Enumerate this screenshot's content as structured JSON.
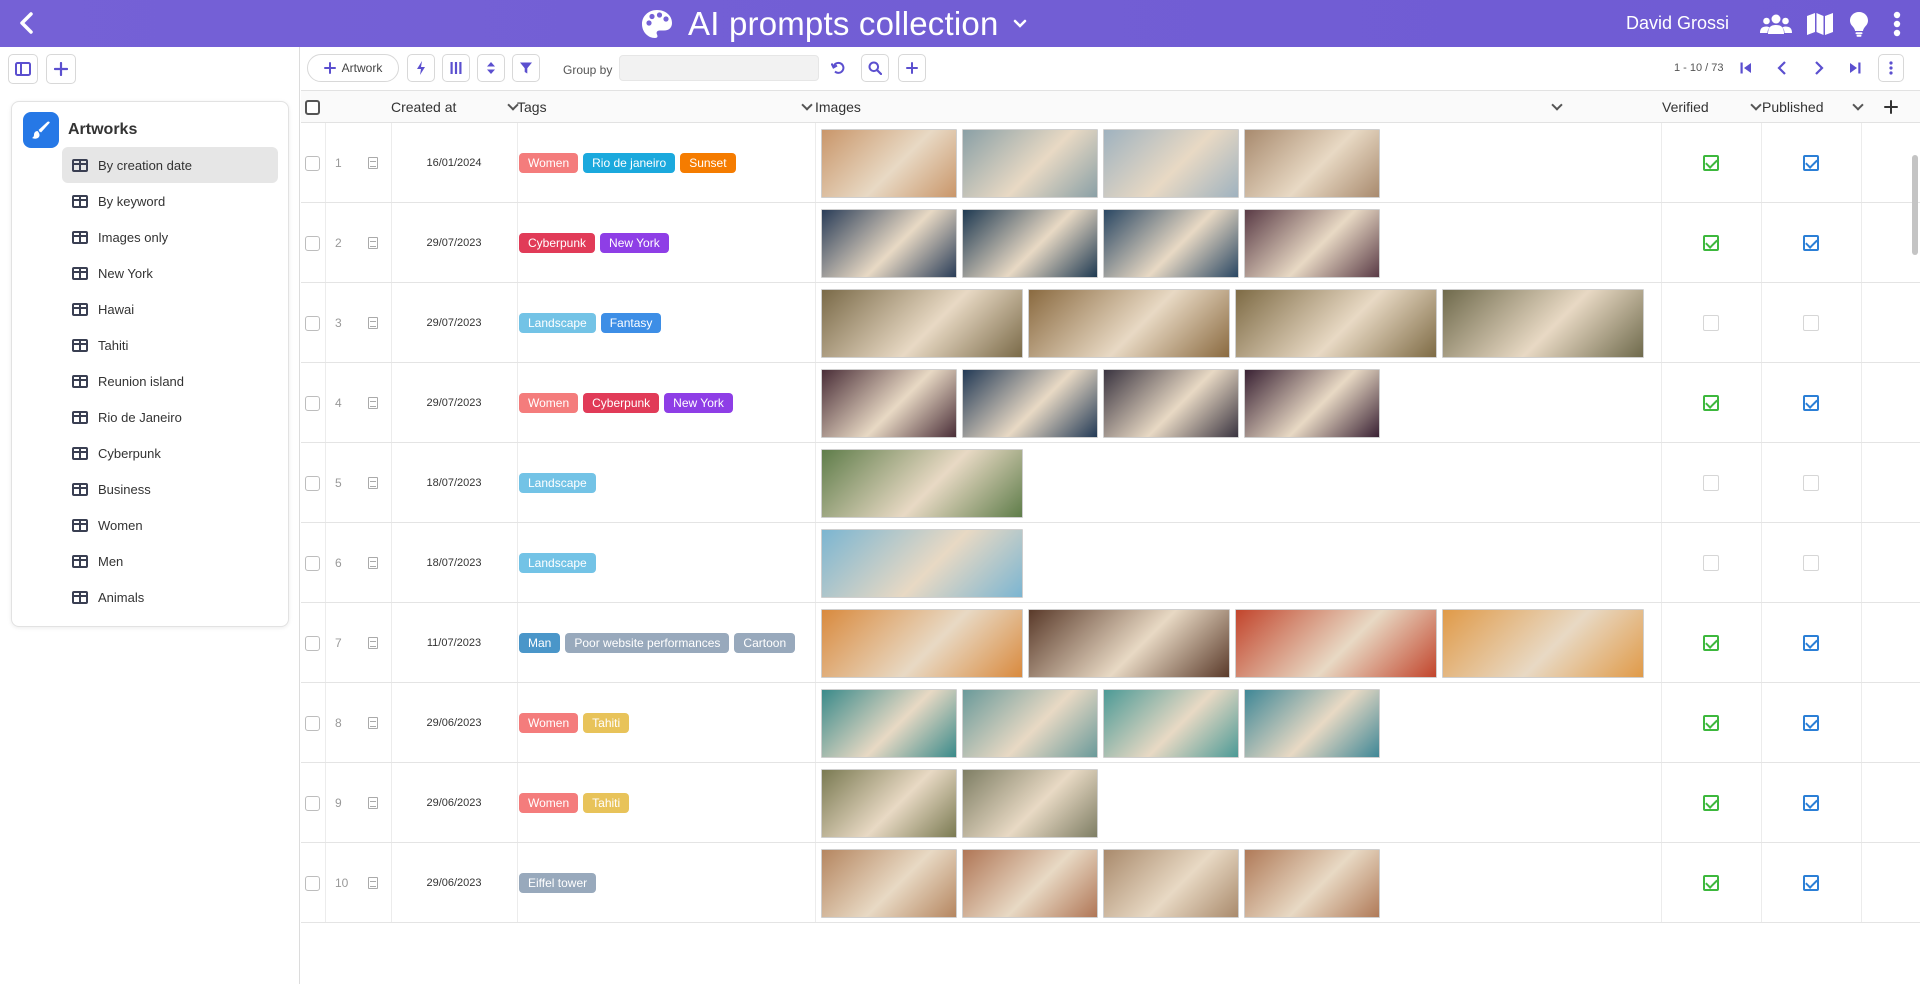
{
  "header": {
    "title": "AI prompts collection",
    "user": "David Grossi",
    "icons": [
      "back-icon",
      "palette-icon",
      "chevron-down-icon",
      "users-icon",
      "map-icon",
      "lightbulb-icon",
      "more-vertical-icon"
    ]
  },
  "sidebar": {
    "category": "Artworks",
    "items": [
      {
        "label": "By creation date",
        "active": true
      },
      {
        "label": "By keyword"
      },
      {
        "label": "Images only"
      },
      {
        "label": "New York"
      },
      {
        "label": "Hawai"
      },
      {
        "label": "Tahiti"
      },
      {
        "label": "Reunion island"
      },
      {
        "label": "Rio de Janeiro"
      },
      {
        "label": "Cyberpunk"
      },
      {
        "label": "Business"
      },
      {
        "label": "Women"
      },
      {
        "label": "Men"
      },
      {
        "label": "Animals"
      }
    ]
  },
  "toolbar": {
    "add_label": "Artwork",
    "group_by_label": "Group by",
    "group_by_value": "",
    "pagination": "1 - 10 / 73"
  },
  "columns": {
    "created_at": "Created at",
    "tags": "Tags",
    "images": "Images",
    "verified": "Verified",
    "published": "Published"
  },
  "colors": {
    "header": "#7561d6",
    "accent": "#5b4fcf",
    "verified": "#3db83d",
    "published": "#2b7fd6"
  },
  "rows": [
    {
      "num": "1",
      "date": "16/01/2024",
      "tags": [
        {
          "label": "Women",
          "color": "#f47c7c"
        },
        {
          "label": "Rio de janeiro",
          "color": "#1ba9dd"
        },
        {
          "label": "Sunset",
          "color": "#f57c00"
        }
      ],
      "images": [
        {
          "w": "n",
          "c": "#c9966a"
        },
        {
          "w": "n",
          "c": "#8aa0a6"
        },
        {
          "w": "n",
          "c": "#9fb2bf"
        },
        {
          "w": "n",
          "c": "#a88a6e"
        }
      ],
      "verified": true,
      "published": true
    },
    {
      "num": "2",
      "date": "29/07/2023",
      "tags": [
        {
          "label": "Cyberpunk",
          "color": "#e13b58"
        },
        {
          "label": "New York",
          "color": "#8e3ee6"
        }
      ],
      "images": [
        {
          "w": "n",
          "c": "#2a3d58"
        },
        {
          "w": "n",
          "c": "#1f3a52"
        },
        {
          "w": "n",
          "c": "#2a4763"
        },
        {
          "w": "n",
          "c": "#5a3b46"
        }
      ],
      "verified": true,
      "published": true
    },
    {
      "num": "3",
      "date": "29/07/2023",
      "tags": [
        {
          "label": "Landscape",
          "color": "#73c3e6"
        },
        {
          "label": "Fantasy",
          "color": "#3d8ee6"
        }
      ],
      "images": [
        {
          "w": "w",
          "c": "#7a6a48"
        },
        {
          "w": "w",
          "c": "#8a6a40"
        },
        {
          "w": "w",
          "c": "#7e6b45"
        },
        {
          "w": "w",
          "c": "#6f6a4c"
        }
      ],
      "verified": false,
      "published": false
    },
    {
      "num": "4",
      "date": "29/07/2023",
      "tags": [
        {
          "label": "Women",
          "color": "#f47c7c"
        },
        {
          "label": "Cyberpunk",
          "color": "#e13b58"
        },
        {
          "label": "New York",
          "color": "#8e3ee6"
        }
      ],
      "images": [
        {
          "w": "n",
          "c": "#4a2e38"
        },
        {
          "w": "n",
          "c": "#233a56"
        },
        {
          "w": "n",
          "c": "#3a3440"
        },
        {
          "w": "n",
          "c": "#3a2234"
        }
      ],
      "verified": true,
      "published": true
    },
    {
      "num": "5",
      "date": "18/07/2023",
      "tags": [
        {
          "label": "Landscape",
          "color": "#73c3e6"
        }
      ],
      "images": [
        {
          "w": "w",
          "c": "#5f7d4a"
        }
      ],
      "verified": false,
      "published": false
    },
    {
      "num": "6",
      "date": "18/07/2023",
      "tags": [
        {
          "label": "Landscape",
          "color": "#73c3e6"
        }
      ],
      "images": [
        {
          "w": "w",
          "c": "#7bb5d1"
        }
      ],
      "verified": false,
      "published": false
    },
    {
      "num": "7",
      "date": "11/07/2023",
      "tags": [
        {
          "label": "Man",
          "color": "#4a96c9"
        },
        {
          "label": "Poor website performances",
          "color": "#98a9bc"
        },
        {
          "label": "Cartoon",
          "color": "#98a9bc"
        }
      ],
      "images": [
        {
          "w": "w",
          "c": "#d98a3e"
        },
        {
          "w": "w",
          "c": "#5a3a2a"
        },
        {
          "w": "w",
          "c": "#c2452c"
        },
        {
          "w": "w",
          "c": "#e09a48"
        }
      ],
      "verified": true,
      "published": true
    },
    {
      "num": "8",
      "date": "29/06/2023",
      "tags": [
        {
          "label": "Women",
          "color": "#f47c7c"
        },
        {
          "label": "Tahiti",
          "color": "#e8c35a"
        }
      ],
      "images": [
        {
          "w": "n",
          "c": "#3a8a8a"
        },
        {
          "w": "n",
          "c": "#6a9a9a"
        },
        {
          "w": "n",
          "c": "#4c9a96"
        },
        {
          "w": "n",
          "c": "#3f8796"
        }
      ],
      "verified": true,
      "published": true
    },
    {
      "num": "9",
      "date": "29/06/2023",
      "tags": [
        {
          "label": "Women",
          "color": "#f47c7c"
        },
        {
          "label": "Tahiti",
          "color": "#e8c35a"
        }
      ],
      "images": [
        {
          "w": "n",
          "c": "#7a7a52"
        },
        {
          "w": "n",
          "c": "#7e7e64"
        }
      ],
      "verified": true,
      "published": true
    },
    {
      "num": "10",
      "date": "29/06/2023",
      "tags": [
        {
          "label": "Eiffel tower",
          "color": "#98a9bc"
        }
      ],
      "images": [
        {
          "w": "n",
          "c": "#b58660"
        },
        {
          "w": "n",
          "c": "#b07656"
        },
        {
          "w": "n",
          "c": "#a98a6c"
        },
        {
          "w": "n",
          "c": "#b07a58"
        }
      ],
      "verified": true,
      "published": true
    }
  ]
}
